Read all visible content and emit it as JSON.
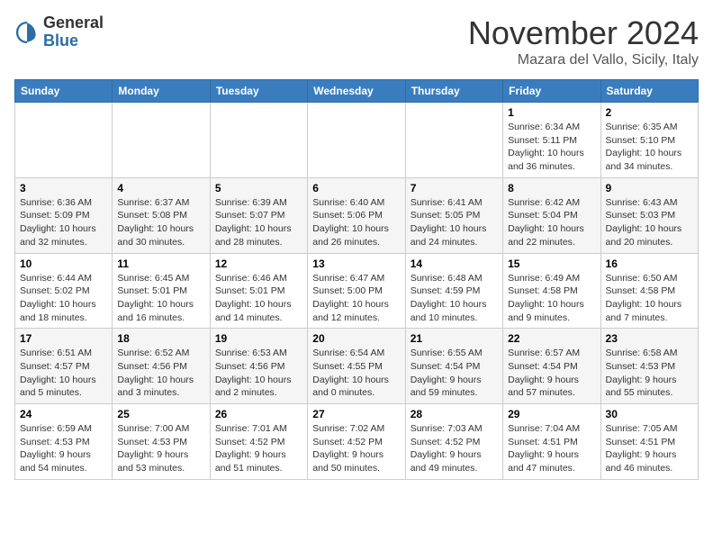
{
  "header": {
    "logo_line1": "General",
    "logo_line2": "Blue",
    "month": "November 2024",
    "location": "Mazara del Vallo, Sicily, Italy"
  },
  "days_of_week": [
    "Sunday",
    "Monday",
    "Tuesday",
    "Wednesday",
    "Thursday",
    "Friday",
    "Saturday"
  ],
  "weeks": [
    [
      {
        "day": "",
        "info": ""
      },
      {
        "day": "",
        "info": ""
      },
      {
        "day": "",
        "info": ""
      },
      {
        "day": "",
        "info": ""
      },
      {
        "day": "",
        "info": ""
      },
      {
        "day": "1",
        "info": "Sunrise: 6:34 AM\nSunset: 5:11 PM\nDaylight: 10 hours\nand 36 minutes."
      },
      {
        "day": "2",
        "info": "Sunrise: 6:35 AM\nSunset: 5:10 PM\nDaylight: 10 hours\nand 34 minutes."
      }
    ],
    [
      {
        "day": "3",
        "info": "Sunrise: 6:36 AM\nSunset: 5:09 PM\nDaylight: 10 hours\nand 32 minutes."
      },
      {
        "day": "4",
        "info": "Sunrise: 6:37 AM\nSunset: 5:08 PM\nDaylight: 10 hours\nand 30 minutes."
      },
      {
        "day": "5",
        "info": "Sunrise: 6:39 AM\nSunset: 5:07 PM\nDaylight: 10 hours\nand 28 minutes."
      },
      {
        "day": "6",
        "info": "Sunrise: 6:40 AM\nSunset: 5:06 PM\nDaylight: 10 hours\nand 26 minutes."
      },
      {
        "day": "7",
        "info": "Sunrise: 6:41 AM\nSunset: 5:05 PM\nDaylight: 10 hours\nand 24 minutes."
      },
      {
        "day": "8",
        "info": "Sunrise: 6:42 AM\nSunset: 5:04 PM\nDaylight: 10 hours\nand 22 minutes."
      },
      {
        "day": "9",
        "info": "Sunrise: 6:43 AM\nSunset: 5:03 PM\nDaylight: 10 hours\nand 20 minutes."
      }
    ],
    [
      {
        "day": "10",
        "info": "Sunrise: 6:44 AM\nSunset: 5:02 PM\nDaylight: 10 hours\nand 18 minutes."
      },
      {
        "day": "11",
        "info": "Sunrise: 6:45 AM\nSunset: 5:01 PM\nDaylight: 10 hours\nand 16 minutes."
      },
      {
        "day": "12",
        "info": "Sunrise: 6:46 AM\nSunset: 5:01 PM\nDaylight: 10 hours\nand 14 minutes."
      },
      {
        "day": "13",
        "info": "Sunrise: 6:47 AM\nSunset: 5:00 PM\nDaylight: 10 hours\nand 12 minutes."
      },
      {
        "day": "14",
        "info": "Sunrise: 6:48 AM\nSunset: 4:59 PM\nDaylight: 10 hours\nand 10 minutes."
      },
      {
        "day": "15",
        "info": "Sunrise: 6:49 AM\nSunset: 4:58 PM\nDaylight: 10 hours\nand 9 minutes."
      },
      {
        "day": "16",
        "info": "Sunrise: 6:50 AM\nSunset: 4:58 PM\nDaylight: 10 hours\nand 7 minutes."
      }
    ],
    [
      {
        "day": "17",
        "info": "Sunrise: 6:51 AM\nSunset: 4:57 PM\nDaylight: 10 hours\nand 5 minutes."
      },
      {
        "day": "18",
        "info": "Sunrise: 6:52 AM\nSunset: 4:56 PM\nDaylight: 10 hours\nand 3 minutes."
      },
      {
        "day": "19",
        "info": "Sunrise: 6:53 AM\nSunset: 4:56 PM\nDaylight: 10 hours\nand 2 minutes."
      },
      {
        "day": "20",
        "info": "Sunrise: 6:54 AM\nSunset: 4:55 PM\nDaylight: 10 hours\nand 0 minutes."
      },
      {
        "day": "21",
        "info": "Sunrise: 6:55 AM\nSunset: 4:54 PM\nDaylight: 9 hours\nand 59 minutes."
      },
      {
        "day": "22",
        "info": "Sunrise: 6:57 AM\nSunset: 4:54 PM\nDaylight: 9 hours\nand 57 minutes."
      },
      {
        "day": "23",
        "info": "Sunrise: 6:58 AM\nSunset: 4:53 PM\nDaylight: 9 hours\nand 55 minutes."
      }
    ],
    [
      {
        "day": "24",
        "info": "Sunrise: 6:59 AM\nSunset: 4:53 PM\nDaylight: 9 hours\nand 54 minutes."
      },
      {
        "day": "25",
        "info": "Sunrise: 7:00 AM\nSunset: 4:53 PM\nDaylight: 9 hours\nand 53 minutes."
      },
      {
        "day": "26",
        "info": "Sunrise: 7:01 AM\nSunset: 4:52 PM\nDaylight: 9 hours\nand 51 minutes."
      },
      {
        "day": "27",
        "info": "Sunrise: 7:02 AM\nSunset: 4:52 PM\nDaylight: 9 hours\nand 50 minutes."
      },
      {
        "day": "28",
        "info": "Sunrise: 7:03 AM\nSunset: 4:52 PM\nDaylight: 9 hours\nand 49 minutes."
      },
      {
        "day": "29",
        "info": "Sunrise: 7:04 AM\nSunset: 4:51 PM\nDaylight: 9 hours\nand 47 minutes."
      },
      {
        "day": "30",
        "info": "Sunrise: 7:05 AM\nSunset: 4:51 PM\nDaylight: 9 hours\nand 46 minutes."
      }
    ]
  ]
}
